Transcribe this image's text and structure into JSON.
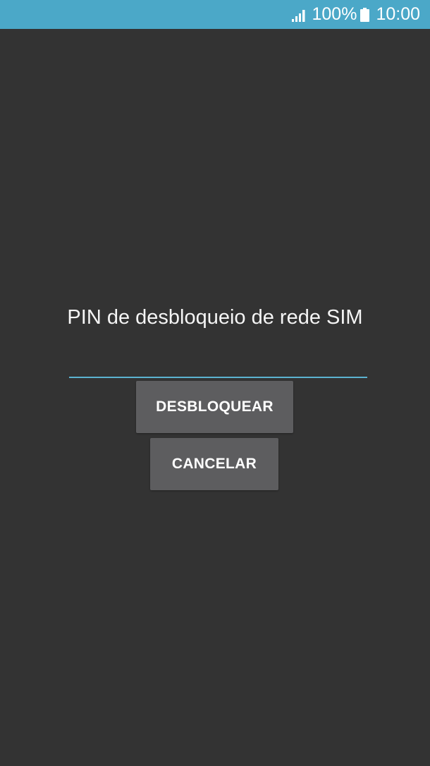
{
  "status_bar": {
    "signal_icon": "signal-bars-icon",
    "battery_percent": "100%",
    "battery_icon": "battery-full-icon",
    "time": "10:00",
    "color": "#4ba8c8"
  },
  "dialog": {
    "title": "PIN de desbloqueio de rede SIM",
    "pin_value": "",
    "unlock_label": "DESBLOQUEAR",
    "cancel_label": "CANCELAR",
    "accent_color": "#5bb3d1",
    "background_color": "#333333",
    "button_color": "#5d5d5f"
  }
}
